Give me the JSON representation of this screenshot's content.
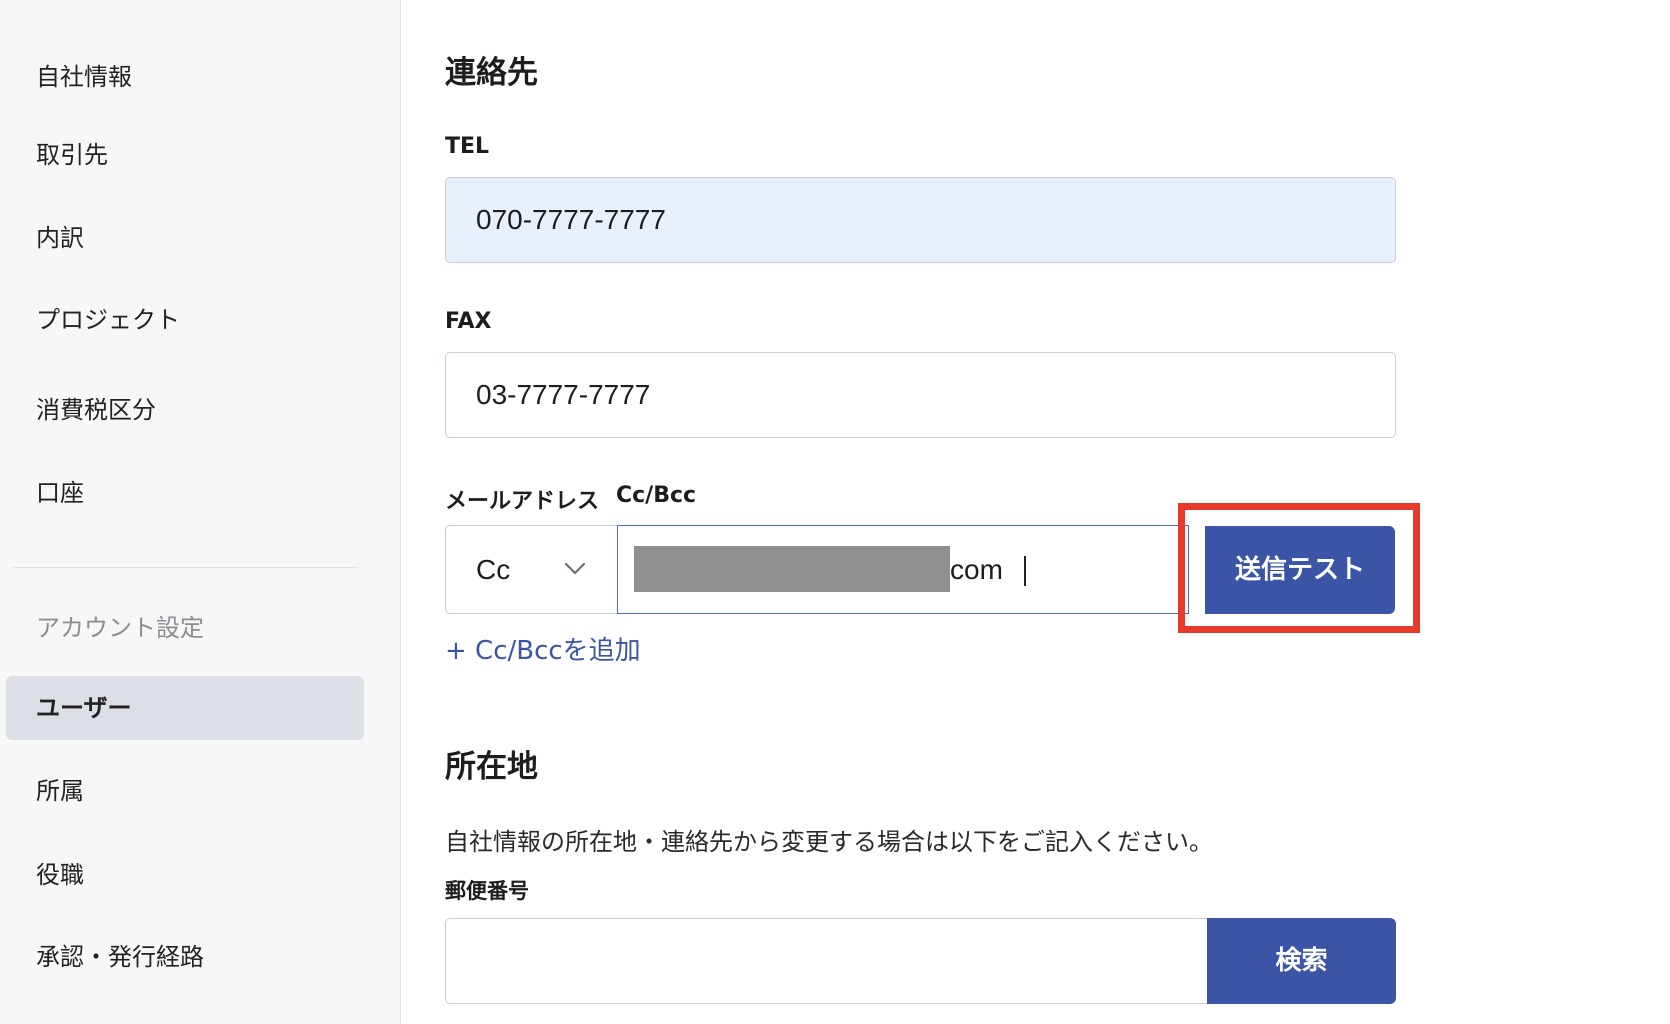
{
  "sidebar": {
    "items": [
      {
        "label": "自社情報"
      },
      {
        "label": "取引先"
      },
      {
        "label": "内訳"
      },
      {
        "label": "プロジェクト"
      },
      {
        "label": "消費税区分"
      },
      {
        "label": "口座"
      }
    ],
    "account_section_title": "アカウント設定",
    "account_items": [
      {
        "label": "ユーザー",
        "active": true
      },
      {
        "label": "所属"
      },
      {
        "label": "役職"
      },
      {
        "label": "承認・発行経路"
      }
    ]
  },
  "contact": {
    "title": "連絡先",
    "tel": {
      "label": "TEL",
      "value": "070-7777-7777"
    },
    "fax": {
      "label": "FAX",
      "value": "03-7777-7777"
    },
    "email": {
      "label": "メールアドレス",
      "cc_bcc_label": "Cc/Bcc",
      "cc_select_value": "Cc",
      "value_suffix": "com",
      "send_test_label": "送信テスト",
      "add_cc_bcc_label": "+ Cc/Bccを追加"
    }
  },
  "address": {
    "title": "所在地",
    "helper_text": "自社情報の所在地・連絡先から変更する場合は以下をご記入ください。",
    "postal_code": {
      "label": "郵便番号",
      "value": ""
    },
    "search_button_label": "検索"
  },
  "colors": {
    "primary": "#3a55a6",
    "highlight": "#e8392d",
    "filled_input_bg": "#e8f0fd",
    "sidebar_active_bg": "#dcdfe5"
  }
}
